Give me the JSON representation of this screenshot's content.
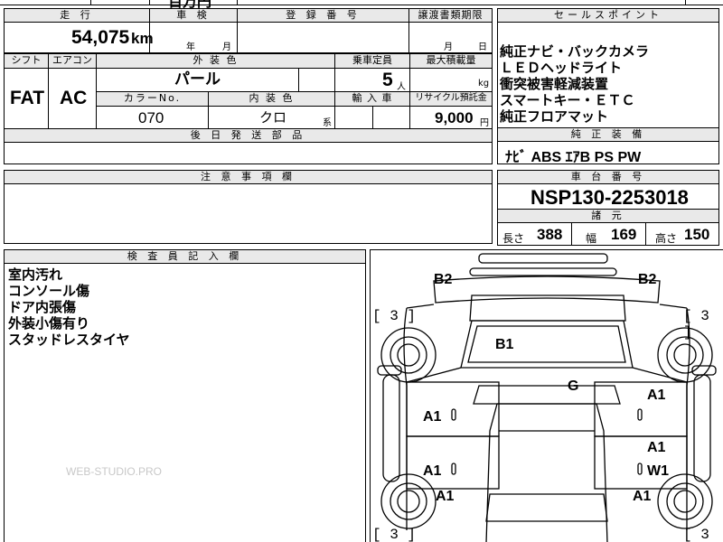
{
  "top_strip": {
    "partial_text": "百万円"
  },
  "row1": {
    "mileage_header": "走 行",
    "mileage_value": "54,075",
    "mileage_unit": "km",
    "inspection_header": "車 検",
    "inspection_year_label": "年",
    "inspection_month_label": "月",
    "registration_header": "登 録 番 号",
    "transfer_header": "譲渡書類期限",
    "transfer_month_label": "月",
    "transfer_day_label": "日"
  },
  "row2": {
    "shift_header": "シフト",
    "shift_value": "FAT",
    "aircon_header": "エアコン",
    "aircon_value": "AC",
    "exterior_header": "外 装 色",
    "exterior_value": "パール",
    "capacity_header": "乗車定員",
    "capacity_value": "5",
    "capacity_unit": "人",
    "maxload_header": "最大積載量",
    "maxload_unit": "kg",
    "colorno_header": "カラーNo.",
    "colorno_value": "070",
    "interior_header": "内 装 色",
    "interior_value": "クロ",
    "interior_suffix": "系",
    "import_header": "輸 入 車",
    "recycle_header": "リサイクル預託金",
    "recycle_value": "9,000",
    "recycle_unit": "円"
  },
  "later_parts_header": "後 日 発 送 部 品",
  "sales_points": {
    "header": "セールスポイント",
    "lines": [
      "純正ナビ・バックカメラ",
      "ＬＥＤヘッドライト",
      "衝突被害軽減装置",
      "スマートキー・ＥＴＣ",
      "純正フロアマット"
    ]
  },
  "genuine_equipment": {
    "header": "純 正 装 備",
    "value": "ﾅﾋﾞ ABS ｴｱB PS PW"
  },
  "notes_header": "注 意 事 項 欄",
  "chassis": {
    "header": "車 台 番 号",
    "value": "NSP130-2253018"
  },
  "specs": {
    "header": "諸 元",
    "length_label": "長さ",
    "length_value": "388",
    "width_label": "幅",
    "width_value": "169",
    "height_label": "高さ",
    "height_value": "150"
  },
  "inspector": {
    "header": "検 査 員 記 入 欄",
    "lines": [
      "室内汚れ",
      "コンソール傷",
      "ドア内張傷",
      "外装小傷有り",
      "スタッドレスタイヤ"
    ]
  },
  "watermark": "WEB-STUDIO.PRO",
  "diagram": {
    "marks": {
      "b2_left": "B2",
      "b2_right": "B2",
      "b1": "B1",
      "g": "G",
      "a1_r_upper": "A1",
      "a1_l_mid": "A1",
      "a1_r_mid": "A1",
      "a1_l_low": "A1",
      "w1": "W1",
      "a1_l_bottom": "A1",
      "a1_r_bottom": "A1"
    },
    "tires": {
      "tl": "[ 3 ]",
      "tr": "[ 3 ]",
      "bl": "[ 3 ]",
      "br": "[ 3 ]"
    }
  }
}
